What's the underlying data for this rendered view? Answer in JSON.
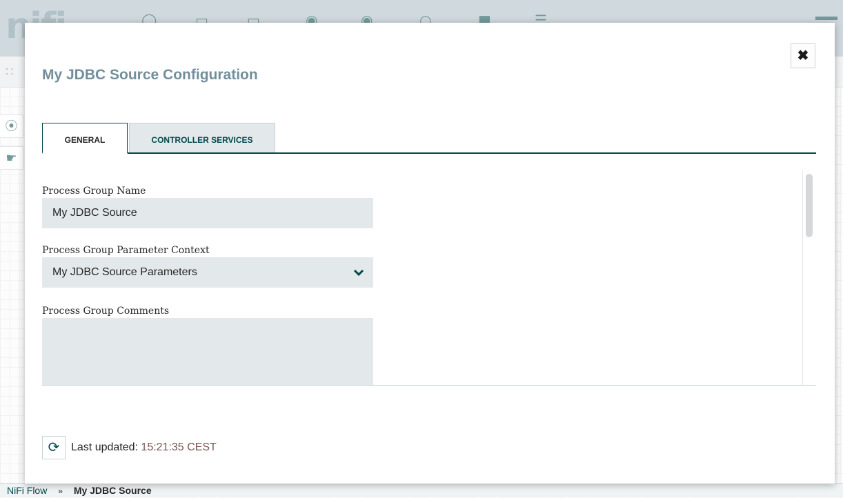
{
  "app": {
    "logo_text": "nifi",
    "toolbar_icons": [
      "processor-icon",
      "input-port-icon",
      "output-port-icon",
      "process-group-icon",
      "remote-process-group-icon",
      "funnel-icon",
      "template-icon",
      "label-icon"
    ]
  },
  "breadcrumbs": {
    "root": "NiFi Flow",
    "separator": "»",
    "current": "My JDBC Source"
  },
  "dialog": {
    "title": "My JDBC Source Configuration",
    "close_icon": "close-icon",
    "tabs": [
      {
        "label": "GENERAL",
        "selected": true
      },
      {
        "label": "CONTROLLER SERVICES",
        "selected": false
      }
    ],
    "fields": {
      "name": {
        "label": "Process Group Name",
        "value": "My JDBC Source"
      },
      "parameter_context": {
        "label": "Process Group Parameter Context",
        "value": "My JDBC Source Parameters"
      },
      "comments": {
        "label": "Process Group Comments",
        "value": ""
      }
    },
    "footer": {
      "refresh_icon": "refresh-icon",
      "last_updated_label": "Last updated:",
      "last_updated_time": "15:21:35 CEST"
    }
  },
  "colors": {
    "accent": "#004849",
    "title": "#728e9b",
    "input_bg": "#e3e8eb",
    "timestamp": "#775351"
  }
}
